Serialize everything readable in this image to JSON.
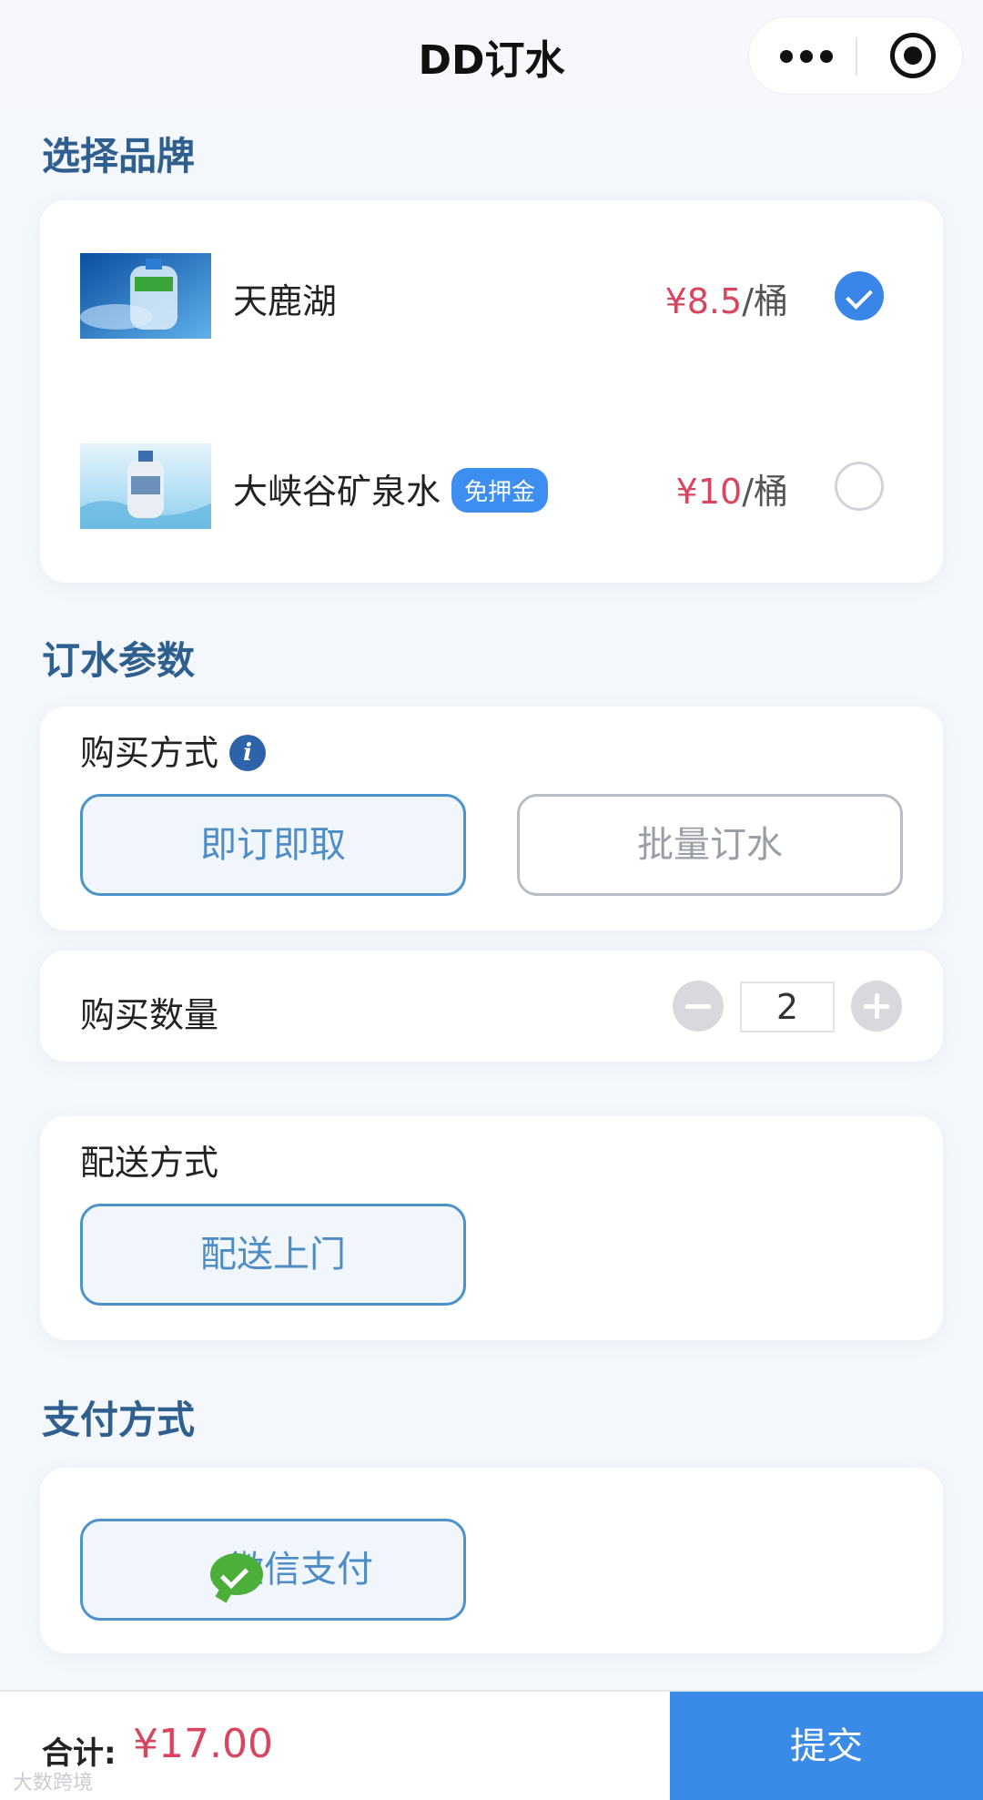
{
  "header": {
    "title": "DD订水",
    "more_icon": "more-dots-icon",
    "close_icon": "target-circle-icon"
  },
  "brand_section": {
    "title": "选择品牌",
    "items": [
      {
        "name": "天鹿湖",
        "badge": "",
        "price": "¥8.5",
        "unit": "/桶",
        "selected": true
      },
      {
        "name": "大峡谷矿泉水",
        "badge": "免押金",
        "price": "¥10",
        "unit": "/桶",
        "selected": false
      }
    ]
  },
  "params_section": {
    "title": "订水参数",
    "purchase_method": {
      "label": "购买方式",
      "info_icon": "i",
      "options": [
        "即订即取",
        "批量订水"
      ],
      "selected": "即订即取"
    },
    "quantity": {
      "label": "购买数量",
      "value": "2"
    },
    "delivery": {
      "label": "配送方式",
      "options": [
        "配送上门"
      ],
      "selected": "配送上门"
    }
  },
  "payment_section": {
    "title": "支付方式",
    "option": "微信支付"
  },
  "footer": {
    "total_label": "合计:",
    "total_amount": "¥17.00",
    "submit_label": "提交"
  },
  "watermark": "大数跨境",
  "colors": {
    "accent": "#3a8ae8",
    "price": "#d9445f",
    "section_title": "#2f5f8f"
  }
}
